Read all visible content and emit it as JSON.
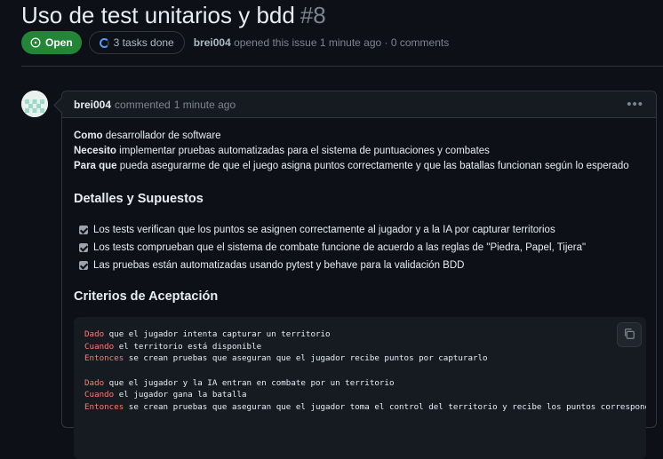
{
  "issue": {
    "title": "Uso de test unitarios y bdd",
    "number": "#8",
    "state": "Open",
    "tasks": "3 tasks done",
    "author": "brei004",
    "meta_rest": "opened this issue 1 minute ago · 0 comments"
  },
  "comment": {
    "author": "brei004",
    "action": "commented",
    "time": "1 minute ago",
    "menu_icon": "kebab-horizontal-icon",
    "story": [
      {
        "bold": "Como",
        "text": " desarrollador de software"
      },
      {
        "bold": "Necesito",
        "text": " implementar pruebas automatizadas para el sistema de puntuaciones y combates"
      },
      {
        "bold": "Para que",
        "text": " pueda asegurarme de que el juego asigna puntos correctamente y que las batallas funcionan según lo esperado"
      }
    ],
    "details_heading": "Detalles y Supuestos",
    "tasks": [
      {
        "text": "Los tests verifican que los puntos se asignen correctamente al jugador y a la IA por capturar territorios",
        "checked": true
      },
      {
        "text": "Los tests comprueban que el sistema de combate funcione de acuerdo a las reglas de \"Piedra, Papel, Tijera\"",
        "checked": true
      },
      {
        "text": "Las pruebas están automatizadas usando pytest y behave para la validación BDD",
        "checked": true
      }
    ],
    "criteria_heading": "Criterios de Aceptación",
    "code": [
      {
        "kw": "Dado",
        "text": " que el jugador intenta capturar un territorio"
      },
      {
        "kw": "Cuando",
        "text": " el territorio está disponible"
      },
      {
        "kw": "Entonces",
        "text": " se crean pruebas que aseguran que el jugador recibe puntos por capturarlo"
      },
      {
        "kw": "",
        "text": ""
      },
      {
        "kw": "Dado",
        "text": " que el jugador y la IA entran en combate por un territorio"
      },
      {
        "kw": "Cuando",
        "text": " el jugador gana la batalla"
      },
      {
        "kw": "Entonces",
        "text": " se crean pruebas que aseguran que el jugador toma el control del territorio y recibe los puntos correspondientes"
      }
    ]
  },
  "colors": {
    "open_green": "#238636",
    "keyword_red": "#ff7b72",
    "background": "#0d1117"
  }
}
